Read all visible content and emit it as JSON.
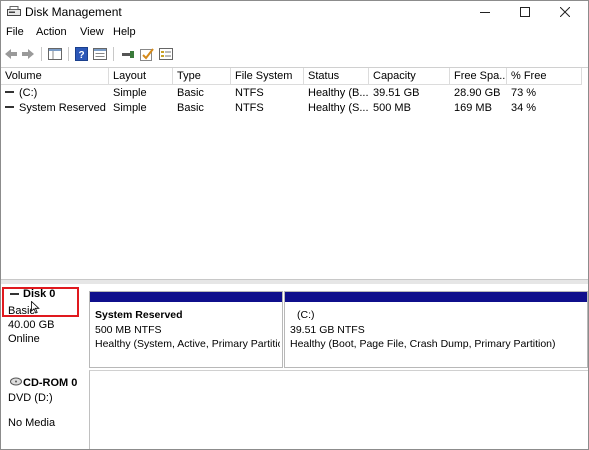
{
  "window": {
    "title": "Disk Management"
  },
  "menu": [
    "File",
    "Action",
    "View",
    "Help"
  ],
  "toolbar": {
    "icons": [
      "back-icon",
      "forward-icon",
      "console-tree-icon",
      "help-icon",
      "properties-icon",
      "connect-icon",
      "check-icon",
      "list-icon"
    ]
  },
  "volume_list": {
    "columns": [
      "Volume",
      "Layout",
      "Type",
      "File System",
      "Status",
      "Capacity",
      "Free Spa...",
      "% Free"
    ],
    "rows": [
      [
        "(C:)",
        "Simple",
        "Basic",
        "NTFS",
        "Healthy (B...",
        "39.51 GB",
        "28.90 GB",
        "73 %"
      ],
      [
        "System Reserved",
        "Simple",
        "Basic",
        "NTFS",
        "Healthy (S...",
        "500 MB",
        "169 MB",
        "34 %"
      ]
    ]
  },
  "disks": [
    {
      "name": "Disk 0",
      "type": "Basic",
      "size": "40.00 GB",
      "status": "Online",
      "partitions": [
        {
          "name": "System Reserved",
          "detail": "500 MB NTFS",
          "status": "Healthy (System, Active, Primary Partitio"
        },
        {
          "name": "(C:)",
          "detail": "39.51 GB NTFS",
          "status": "Healthy (Boot, Page File, Crash Dump, Primary Partition)"
        }
      ]
    },
    {
      "name": "CD-ROM 0",
      "type": "DVD (D:)",
      "status": "No Media"
    }
  ],
  "colors": {
    "partition_bar": "#0f0f8c",
    "highlight": "#e0191e"
  }
}
